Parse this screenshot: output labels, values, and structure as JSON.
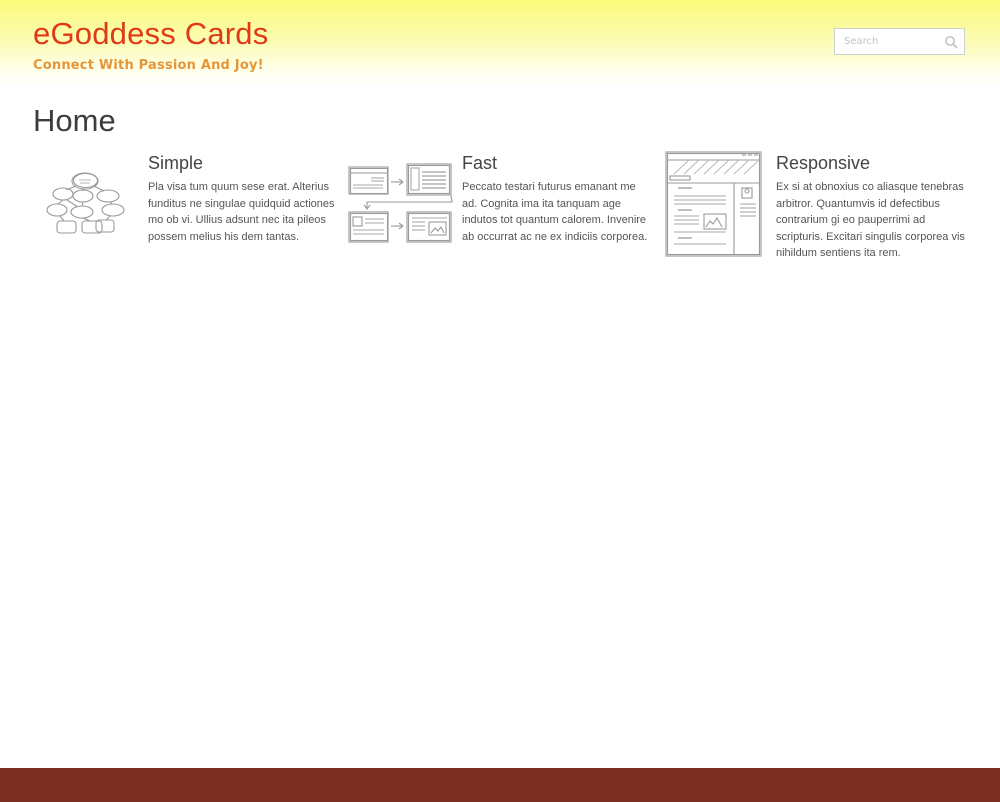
{
  "header": {
    "site_title": "eGoddess Cards",
    "tagline": "Connect With Passion And Joy!",
    "search_placeholder": "Search"
  },
  "main": {
    "page_title": "Home",
    "features": [
      {
        "title": "Simple",
        "text": "Pla visa tum quum sese erat. Alterius funditus ne singulae quidquid actiones mo ob vi. Ullius adsunt nec ita pileos possem melius his dem tantas.",
        "icon": "sitemap-sketch-icon"
      },
      {
        "title": "Fast",
        "text": "Peccato testari futurus emanant me ad. Cognita ima ita tanquam age indutos tot quantum calorem. Invenire ab occurrat ac ne ex indiciis corporea.",
        "icon": "workflow-sketch-icon"
      },
      {
        "title": "Responsive",
        "text": "Ex si at obnoxius co aliasque tenebras arbitror. Quantumvis id defectibus contrarium gi eo pauperrimi ad scripturis. Excitari singulis corporea vis nihildum sentiens ita rem.",
        "icon": "webpage-sketch-icon"
      }
    ]
  },
  "colors": {
    "title": "#e0391a",
    "tagline": "#e5963a",
    "header_gradient_top": "#fafa7a",
    "footer": "#7a2f22"
  }
}
